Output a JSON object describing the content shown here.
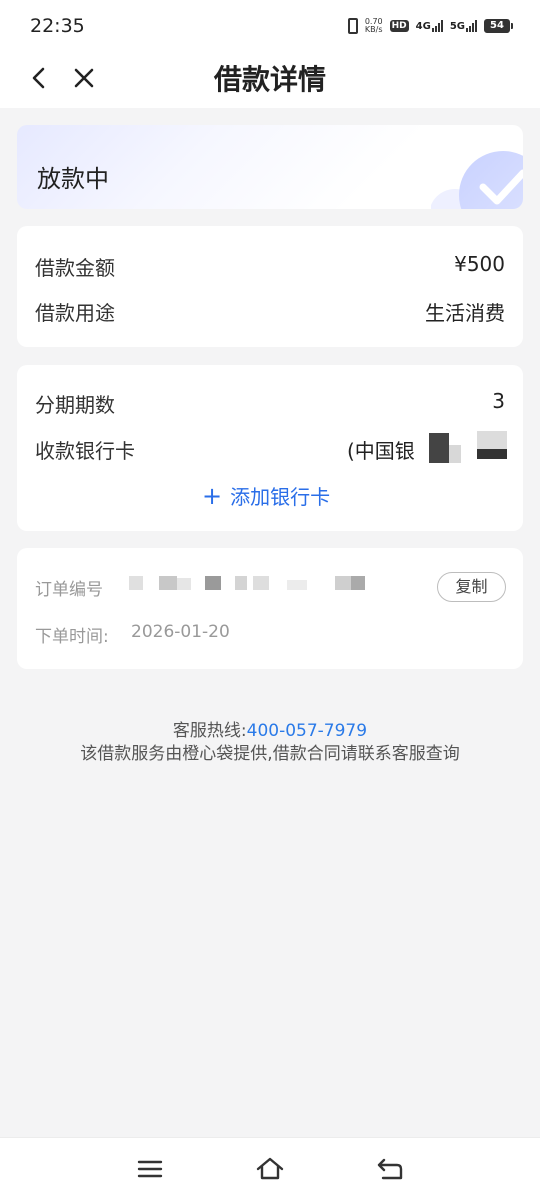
{
  "status_bar": {
    "time": "22:35",
    "net_speed_value": "0.70",
    "net_speed_unit": "KB/s",
    "hd_badge": "HD",
    "sim1": "4G",
    "sim2": "5G",
    "battery": "54"
  },
  "header": {
    "title": "借款详情",
    "back_icon": "chevron-left-icon",
    "close_icon": "close-icon"
  },
  "loan_status": {
    "text": "放款中",
    "icon": "check-circle-icon"
  },
  "amount_card": {
    "amount_label": "借款金额",
    "amount_value": "¥500",
    "purpose_label": "借款用途",
    "purpose_value": "生活消费"
  },
  "bank_card": {
    "installments_label": "分期期数",
    "installments_value": "3",
    "bank_label": "收款银行卡",
    "bank_value": "(中国银",
    "add_bank_label": "添加银行卡"
  },
  "order_card": {
    "order_no_label": "订单编号",
    "copy_label": "复制",
    "order_time_label": "下单时间:",
    "order_time_value": "2026-01-20"
  },
  "footer": {
    "hotline_label": "客服热线:",
    "hotline_number": "400-057-7979",
    "notice": "该借款服务由橙心袋提供,借款合同请联系客服查询"
  },
  "colors": {
    "accent": "#2a6ee8",
    "background": "#f4f4f5"
  }
}
